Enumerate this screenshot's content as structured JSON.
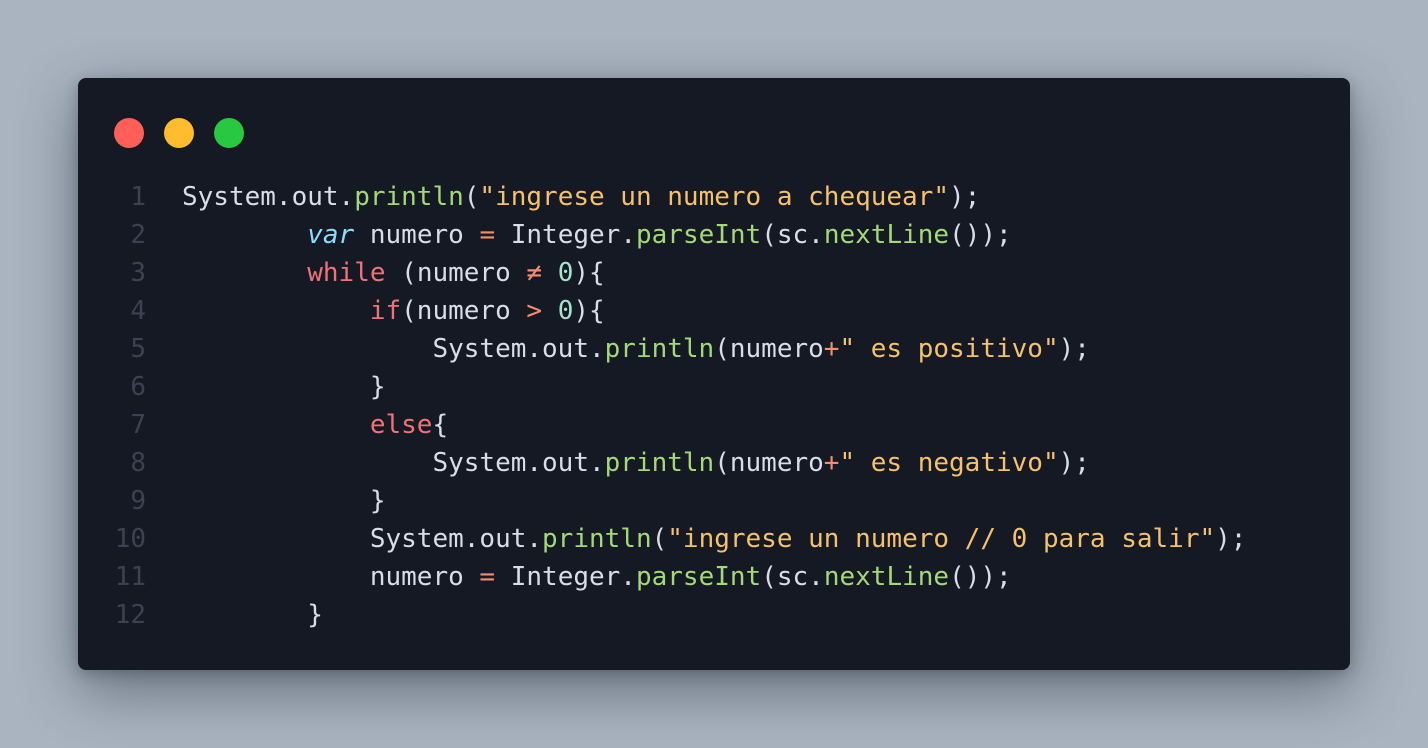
{
  "window": {
    "controls": {
      "close_color": "#ff5f57",
      "minimize_color": "#febc2e",
      "maximize_color": "#28c840"
    }
  },
  "colors": {
    "background": "#a9b4c0",
    "editor_background": "#151924",
    "line_number": "#3b4252",
    "plain": "#d8dee9",
    "function": "#a3d977",
    "string": "#f5c16c",
    "keyword": "#f07178",
    "number": "#a6e3c9",
    "operator": "#f78c6c",
    "keyword_italic": "#89ddff"
  },
  "code": {
    "lines": [
      {
        "number": "1",
        "tokens": [
          {
            "text": "System.out.",
            "type": "plain"
          },
          {
            "text": "println",
            "type": "fn"
          },
          {
            "text": "(",
            "type": "plain"
          },
          {
            "text": "\"ingrese un numero a chequear\"",
            "type": "str"
          },
          {
            "text": ");",
            "type": "plain"
          }
        ]
      },
      {
        "number": "2",
        "tokens": [
          {
            "text": "        ",
            "type": "plain"
          },
          {
            "text": "var",
            "type": "kwi"
          },
          {
            "text": " numero ",
            "type": "plain"
          },
          {
            "text": "=",
            "type": "op"
          },
          {
            "text": " Integer.",
            "type": "plain"
          },
          {
            "text": "parseInt",
            "type": "fn"
          },
          {
            "text": "(sc.",
            "type": "plain"
          },
          {
            "text": "nextLine",
            "type": "fn"
          },
          {
            "text": "());",
            "type": "plain"
          }
        ]
      },
      {
        "number": "3",
        "tokens": [
          {
            "text": "        ",
            "type": "plain"
          },
          {
            "text": "while",
            "type": "kw"
          },
          {
            "text": " (numero ",
            "type": "plain"
          },
          {
            "text": "≠",
            "type": "op"
          },
          {
            "text": " ",
            "type": "plain"
          },
          {
            "text": "0",
            "type": "num"
          },
          {
            "text": "){",
            "type": "plain"
          }
        ]
      },
      {
        "number": "4",
        "tokens": [
          {
            "text": "            ",
            "type": "plain"
          },
          {
            "text": "if",
            "type": "kw"
          },
          {
            "text": "(numero ",
            "type": "plain"
          },
          {
            "text": ">",
            "type": "op"
          },
          {
            "text": " ",
            "type": "plain"
          },
          {
            "text": "0",
            "type": "num"
          },
          {
            "text": "){",
            "type": "plain"
          }
        ]
      },
      {
        "number": "5",
        "tokens": [
          {
            "text": "                System.out.",
            "type": "plain"
          },
          {
            "text": "println",
            "type": "fn"
          },
          {
            "text": "(numero",
            "type": "plain"
          },
          {
            "text": "+",
            "type": "op"
          },
          {
            "text": "\" es positivo\"",
            "type": "str"
          },
          {
            "text": ");",
            "type": "plain"
          }
        ]
      },
      {
        "number": "6",
        "tokens": [
          {
            "text": "            }",
            "type": "plain"
          }
        ]
      },
      {
        "number": "7",
        "tokens": [
          {
            "text": "            ",
            "type": "plain"
          },
          {
            "text": "else",
            "type": "kw"
          },
          {
            "text": "{",
            "type": "plain"
          }
        ]
      },
      {
        "number": "8",
        "tokens": [
          {
            "text": "                System.out.",
            "type": "plain"
          },
          {
            "text": "println",
            "type": "fn"
          },
          {
            "text": "(numero",
            "type": "plain"
          },
          {
            "text": "+",
            "type": "op"
          },
          {
            "text": "\" es negativo\"",
            "type": "str"
          },
          {
            "text": ");",
            "type": "plain"
          }
        ]
      },
      {
        "number": "9",
        "tokens": [
          {
            "text": "            }",
            "type": "plain"
          }
        ]
      },
      {
        "number": "10",
        "tokens": [
          {
            "text": "            System.out.",
            "type": "plain"
          },
          {
            "text": "println",
            "type": "fn"
          },
          {
            "text": "(",
            "type": "plain"
          },
          {
            "text": "\"ingrese un numero // 0 para salir\"",
            "type": "str"
          },
          {
            "text": ");",
            "type": "plain"
          }
        ]
      },
      {
        "number": "11",
        "tokens": [
          {
            "text": "            numero ",
            "type": "plain"
          },
          {
            "text": "=",
            "type": "op"
          },
          {
            "text": " Integer.",
            "type": "plain"
          },
          {
            "text": "parseInt",
            "type": "fn"
          },
          {
            "text": "(sc.",
            "type": "plain"
          },
          {
            "text": "nextLine",
            "type": "fn"
          },
          {
            "text": "());",
            "type": "plain"
          }
        ]
      },
      {
        "number": "12",
        "tokens": [
          {
            "text": "        }",
            "type": "plain"
          }
        ]
      }
    ]
  }
}
